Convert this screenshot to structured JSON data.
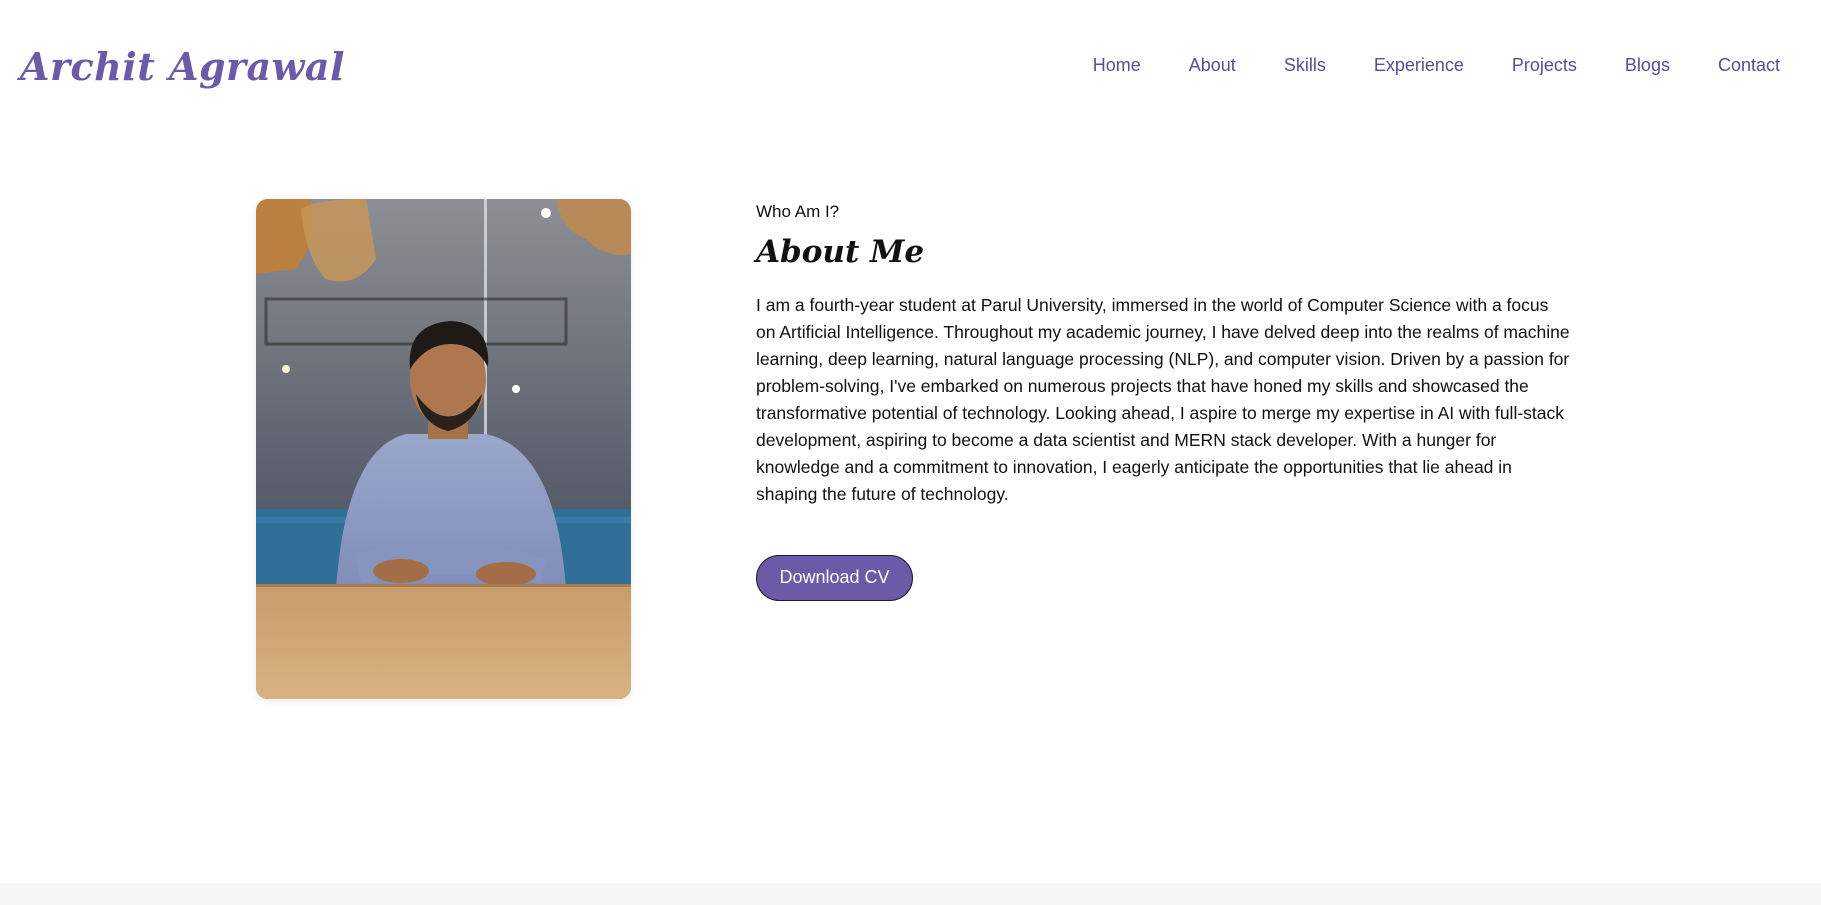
{
  "brand": {
    "name": "Archit Agrawal",
    "color": "#6b5aa8"
  },
  "nav": {
    "items": [
      {
        "label": "Home"
      },
      {
        "label": "About"
      },
      {
        "label": "Skills"
      },
      {
        "label": "Experience"
      },
      {
        "label": "Projects"
      },
      {
        "label": "Blogs"
      },
      {
        "label": "Contact"
      }
    ]
  },
  "about": {
    "eyebrow": "Who Am I?",
    "heading": "About Me",
    "bio": "I am a fourth-year student at Parul University, immersed in the world of Computer Science with a focus on Artificial Intelligence. Throughout my academic journey, I have delved deep into the realms of machine learning, deep learning, natural language processing (NLP), and computer vision. Driven by a passion for problem-solving, I've embarked on numerous projects that have honed my skills and showcased the transformative potential of technology. Looking ahead, I aspire to merge my expertise in AI with full-stack development, aspiring to become a data scientist and MERN stack developer. With a hunger for knowledge and a commitment to innovation, I eagerly anticipate the opportunities that lie ahead in shaping the future of technology.",
    "cv_button": "Download CV",
    "photo_icon": "portrait-photo"
  },
  "colors": {
    "accent": "#6b5aa8",
    "nav_text": "#5b4c9a",
    "body_text": "#111111",
    "footer_bg": "#f7f7f7"
  }
}
